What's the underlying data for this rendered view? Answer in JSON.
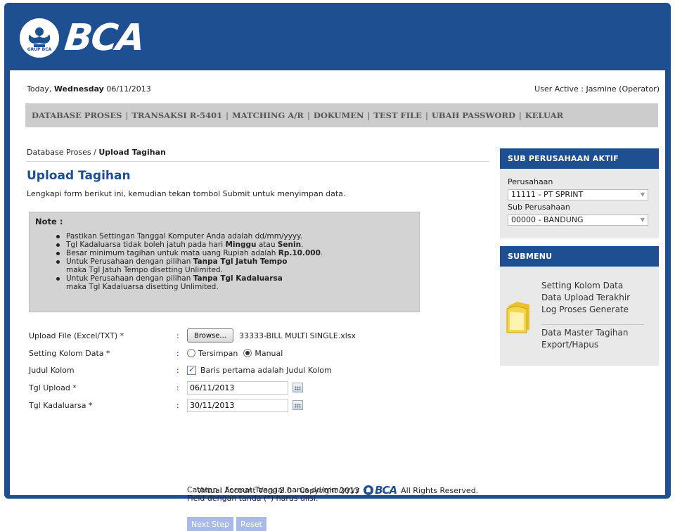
{
  "header": {
    "logo_text": "BCA",
    "seal_text": "GRUP BCA"
  },
  "topbar": {
    "today_prefix": "Today, ",
    "today_day": "Wednesday",
    "today_date": " 06/11/2013",
    "user_active": "User Active : Jasmine (Operator)"
  },
  "menu": {
    "items": [
      "DATABASE PROSES",
      "TRANSAKSI R-5401",
      "MATCHING A/R",
      "DOKUMEN",
      "TEST FILE",
      "UBAH PASSWORD",
      "KELUAR"
    ],
    "separator": "|"
  },
  "breadcrumb": {
    "parent": "Database Proses",
    "sep": " / ",
    "current": "Upload Tagihan"
  },
  "page": {
    "title": "Upload Tagihan",
    "intro": "Lengkapi form berikut ini, kemudian tekan tombol Submit untuk menyimpan data."
  },
  "note": {
    "title": "Note :",
    "items": [
      {
        "pre": "Pastikan Settingan Tanggal Komputer Anda adalah dd/mm/yyyy.",
        "b1": "",
        "mid": "",
        "b2": "",
        "post": ""
      },
      {
        "pre": "Tgl Kadaluarsa tidak boleh jatuh pada hari ",
        "b1": "Minggu",
        "mid": " atau ",
        "b2": "Senin",
        "post": "."
      },
      {
        "pre": "Besar minimum tagihan untuk mata uang Rupiah adalah ",
        "b1": "Rp.10.000",
        "mid": ".",
        "b2": "",
        "post": ""
      },
      {
        "pre": "Untuk Perusahaan dengan pilihan ",
        "b1": "Tanpa Tgl Jatuh Tempo",
        "mid": "",
        "b2": "",
        "post": "",
        "line2": "maka Tgl Jatuh Tempo disetting Unlimited."
      },
      {
        "pre": "Untuk Perusahaan dengan pilihan ",
        "b1": "Tanpa Tgl Kadaluarsa",
        "mid": "",
        "b2": "",
        "post": "",
        "line2": "maka Tgl Kadaluarsa disetting Unlimited."
      }
    ]
  },
  "form": {
    "colon": ":",
    "upload_label": "Upload File (Excel/TXT) *",
    "browse_label": "Browse...",
    "file_name": "33333-BILL MULTI SINGLE.xlsx",
    "setting_label": "Setting Kolom Data *",
    "radio_tersimpan": "Tersimpan",
    "radio_manual": "Manual",
    "judul_label": "Judul Kolom",
    "judul_checkbox": "Baris pertama adalah Judul Kolom",
    "tgl_upload_label": "Tgl Upload *",
    "tgl_upload_value": "06/11/2013",
    "tgl_kadaluarsa_label": "Tgl Kadaluarsa *",
    "tgl_kadaluarsa_value": "30/11/2013",
    "catatan_1": "Catatan : Format Tanggal harus dd/mm/yyyy",
    "catatan_2": "Field dengan tanda (*) harus diisi.",
    "next_button": "Next Step",
    "reset_button": "Reset"
  },
  "sub_perusahaan": {
    "title": "SUB PERUSAHAAN AKTIF",
    "perusahaan_label": "Perusahaan",
    "perusahaan_value": "11111 - PT SPRINT",
    "sub_label": "Sub Perusahaan",
    "sub_value": "00000 - BANDUNG"
  },
  "submenu": {
    "title": "SUBMENU",
    "links": [
      "Setting Kolom Data",
      "Data Upload Terakhir",
      "Log Proses Generate",
      "Data Master Tagihan",
      "Export/Hapus"
    ]
  },
  "footer": {
    "left": "Virtual Account Versi 2.0 - Copyright 2013",
    "logo": "BCA",
    "right": "All Rights Reserved."
  },
  "colors": {
    "brand_blue": "#1d4f91",
    "menu_bg": "#cccccc",
    "button_bg": "#a9b9e9"
  }
}
